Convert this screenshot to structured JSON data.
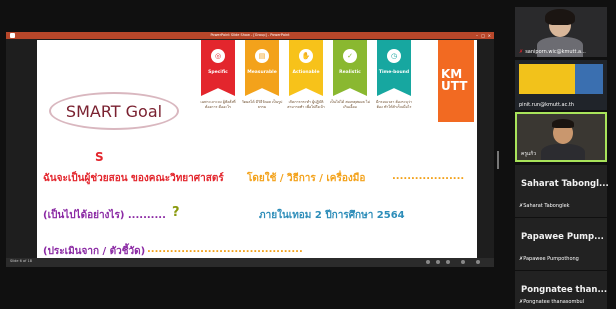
{
  "presentation": {
    "window_title": "PowerPoint Slide Show - [Group] - PowerPoint",
    "slide_counter": "Slide 6 of 18",
    "accent_color": "#b7472a"
  },
  "slide": {
    "smart_label": "SMART Goal",
    "cards": [
      {
        "label": "Specific",
        "desc": "เฉพาะเจาะจง ผู้ฟังสั่งที่ต้องการ คืออะไร",
        "color": "#e3262d",
        "icon": "target-icon"
      },
      {
        "label": "Measurable",
        "desc": "วัดผลได้ มีวิธีวัดผล เป็นรูปธรรม",
        "color": "#f3a21b",
        "icon": "ruler-icon"
      },
      {
        "label": "Actionable",
        "desc": "เกิดการกระทำ ผู้ปฏิบัติสามารถทำ เพื่อไปถึงเป้า",
        "color": "#f7c21a",
        "icon": "hand-icon"
      },
      {
        "label": "Realistic",
        "desc": "เป็นไปได้ สมเหตุสมผล ไม่เกินเอื้อม",
        "color": "#8ab830",
        "icon": "check-icon"
      },
      {
        "label": "Time-bound",
        "desc": "มีกรอบเวลา ต้องระบุว่าต้อง ทำให้สำเร็จเมื่อไร",
        "color": "#17a7a0",
        "icon": "clock-icon"
      }
    ],
    "logo_text": "KM UTT",
    "s_letter": "S",
    "line1_part1": "ฉันจะเป็นผู้ช่วยสอน ของคณะวิทยาศาสตร์",
    "line1_part2": "โดยใช้ / วิธีการ / เครื่องมือ",
    "line1_part3": "...................",
    "line2_part1": "(เป็นไปได้อย่างไร) ..........",
    "line2_qmark": "?",
    "line2_part2": "ภายในเทอม 2 ปีการศึกษา 2564",
    "line3_part1": "(ประเมินจาก / ตัวชี้วัด)",
    "line3_part2": "........................................."
  },
  "participants": {
    "video_tiles": [
      {
        "name": "saniporn.wic@kmutt.a..."
      },
      {
        "name": "pinit.run@kmutt.ac.th"
      },
      {
        "name": "ครูแก้ว"
      }
    ],
    "name_tiles": [
      {
        "big": "Saharat Tabongl...",
        "small": "Saharat Tabonglek"
      },
      {
        "big": "Papawee Pump...",
        "small": "Papawee Pumpothong"
      },
      {
        "big": "Pongnatee than...",
        "small": "Pongnatee thanasombul"
      }
    ],
    "muted_color": "#e3262d",
    "active_speaker_color": "#a8e35a"
  }
}
